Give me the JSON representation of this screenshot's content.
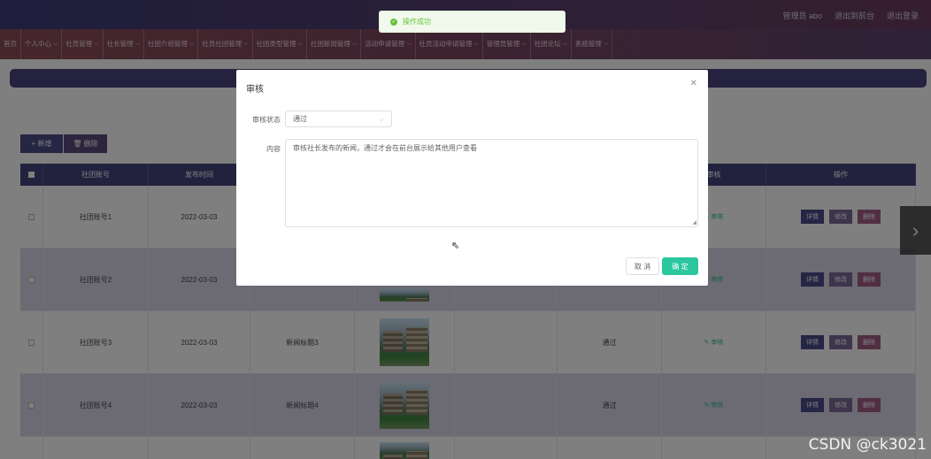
{
  "header": {
    "links": [
      "管理员 abo",
      "退出到前台",
      "退出登录"
    ]
  },
  "nav": [
    "首页",
    "个人中心",
    "社员管理",
    "社长管理",
    "社团介绍管理",
    "社员社团管理",
    "社团类型管理",
    "社团新闻管理",
    "活动申请管理",
    "社员活动申请管理",
    "管理员管理",
    "社团论坛",
    "系统管理"
  ],
  "toolbar": {
    "add_label": "+ 新增",
    "delete_label": "删除"
  },
  "table": {
    "headers": [
      "",
      "社团账号",
      "发布时间",
      "",
      "",
      "",
      "",
      "审核",
      "操作"
    ],
    "rows": [
      {
        "account": "社团账号1",
        "date": "2022-03-03",
        "title": "",
        "status": "",
        "audit": "审核"
      },
      {
        "account": "社团账号2",
        "date": "2022-03-03",
        "title": "",
        "status": "",
        "audit": "审核"
      },
      {
        "account": "社团账号3",
        "date": "2022-03-03",
        "title": "新闻标题3",
        "status": "通过",
        "audit": "审核"
      },
      {
        "account": "社团账号4",
        "date": "2022-03-03",
        "title": "新闻标题4",
        "status": "通过",
        "audit": "审核"
      }
    ],
    "ops": {
      "detail": "详情",
      "edit": "修改",
      "delete": "删除"
    }
  },
  "toast": {
    "message": "操作成功"
  },
  "dialog": {
    "title": "审核",
    "status_label": "审核状态",
    "status_value": "通过",
    "content_label": "内容",
    "content_value": "审核社长发布的新闻，通过才会在前台展示给其他用户查看",
    "cancel_label": "取 消",
    "ok_label": "确 定"
  },
  "watermark": "CSDN @ck3021",
  "colors": {
    "accent": "#45447f",
    "ok": "#2dc79f",
    "success": "#67c23a"
  }
}
